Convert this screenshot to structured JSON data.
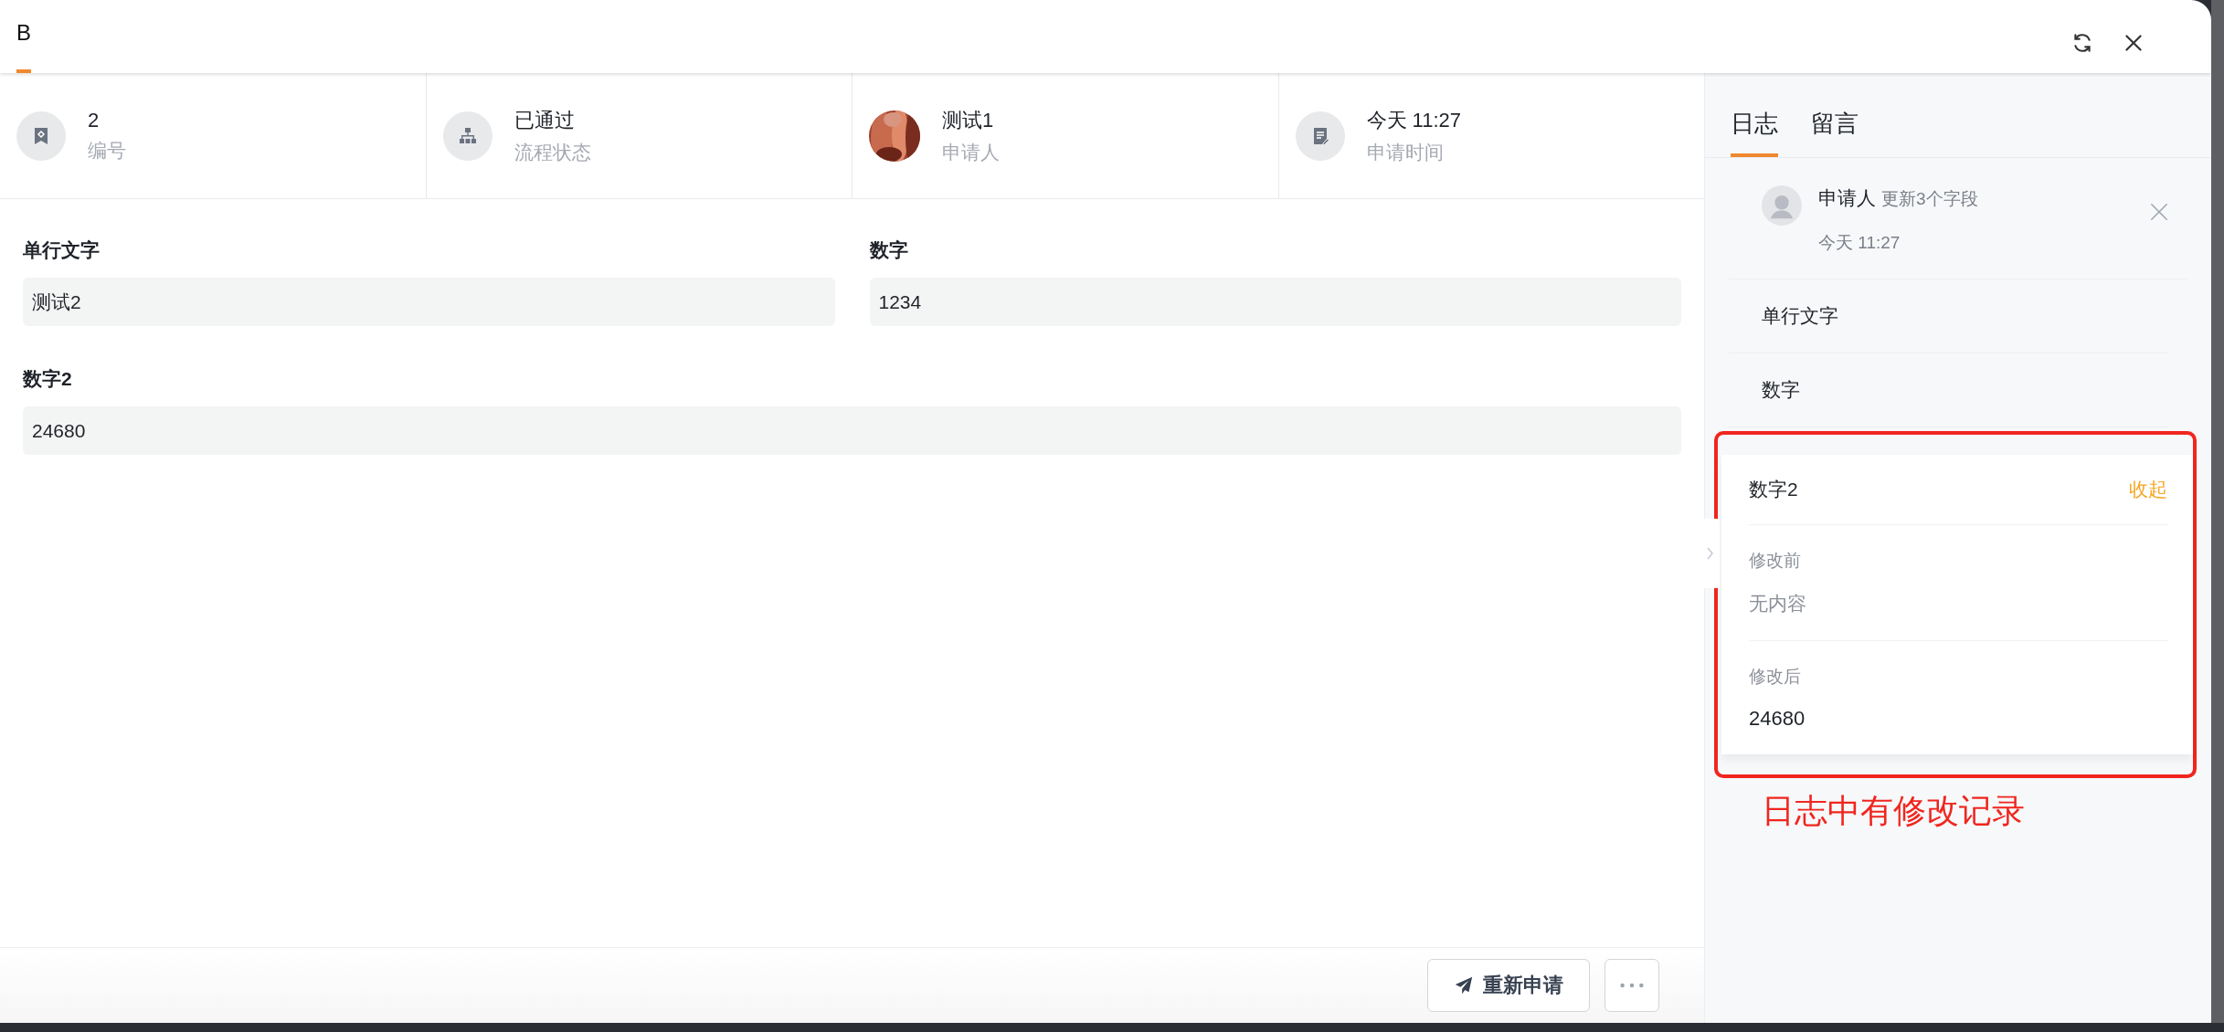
{
  "tabs": [
    {
      "label": "B",
      "selected": true
    }
  ],
  "info": [
    {
      "kind": "serial",
      "value": "2",
      "label": "编号"
    },
    {
      "kind": "status",
      "value": "已通过",
      "label": "流程状态"
    },
    {
      "kind": "avatar",
      "value": "测试1",
      "label": "申请人"
    },
    {
      "kind": "time",
      "value": "今天 11:27",
      "label": "申请时间"
    }
  ],
  "form": {
    "fields": [
      {
        "label": "单行文字",
        "value": "测试2",
        "kind": "half"
      },
      {
        "label": "数字",
        "value": "1234",
        "kind": "half"
      },
      {
        "label": "数字2",
        "value": "24680",
        "kind": "full"
      }
    ]
  },
  "footer": {
    "buttons": [
      {
        "kind": "primary",
        "label": "重新申请"
      },
      {
        "kind": "more"
      }
    ]
  },
  "side_panel": {
    "tabs": [
      {
        "label": "日志",
        "selected": true
      },
      {
        "label": "留言",
        "selected": false
      }
    ],
    "log": {
      "actor": "申请人",
      "action": "更新3个字段",
      "time": "今天 11:27",
      "fields": [
        {
          "name": "单行文字",
          "expanded": false
        },
        {
          "name": "数字",
          "expanded": false
        },
        {
          "name": "数字2",
          "expanded": true,
          "toggle": "收起",
          "before_label": "修改前",
          "before": "无内容",
          "after_label": "修改后",
          "after": "24680"
        }
      ]
    }
  },
  "annotation": {
    "text": "日志中有修改记录"
  }
}
